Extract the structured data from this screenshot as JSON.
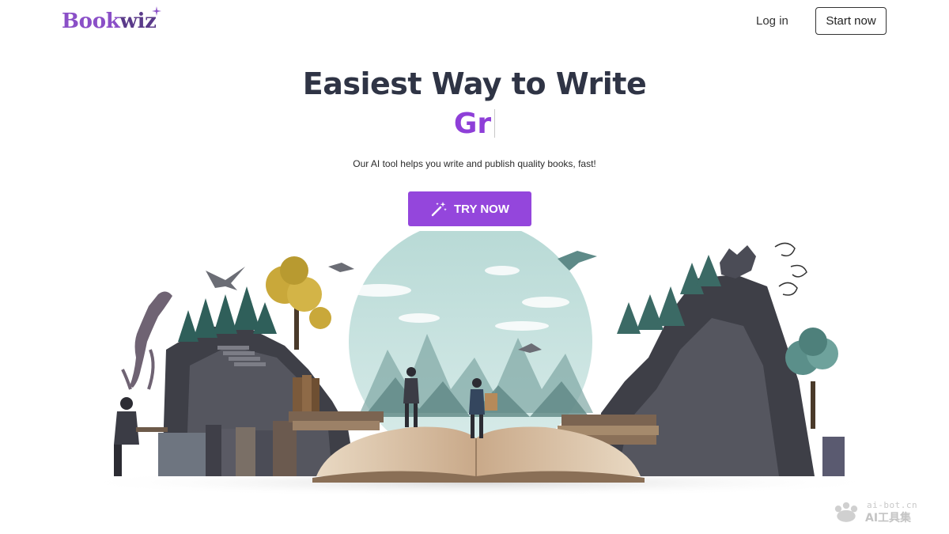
{
  "header": {
    "logo_text_a": "Book",
    "logo_text_b": "wiz",
    "login_label": "Log in",
    "start_label": "Start now"
  },
  "hero": {
    "headline": "Easiest Way to Write",
    "typed_text": "Gr",
    "subtitle": "Our AI tool helps you write and publish quality books, fast!",
    "cta_label": "TRY NOW",
    "cta_icon": "magic-wand-icon"
  },
  "watermark": {
    "line1": "ai-bot.cn",
    "line2": "AI工具集"
  },
  "colors": {
    "brand_purple": "#9446dc",
    "headline": "#2f3445",
    "typed": "#8e3fd8"
  }
}
